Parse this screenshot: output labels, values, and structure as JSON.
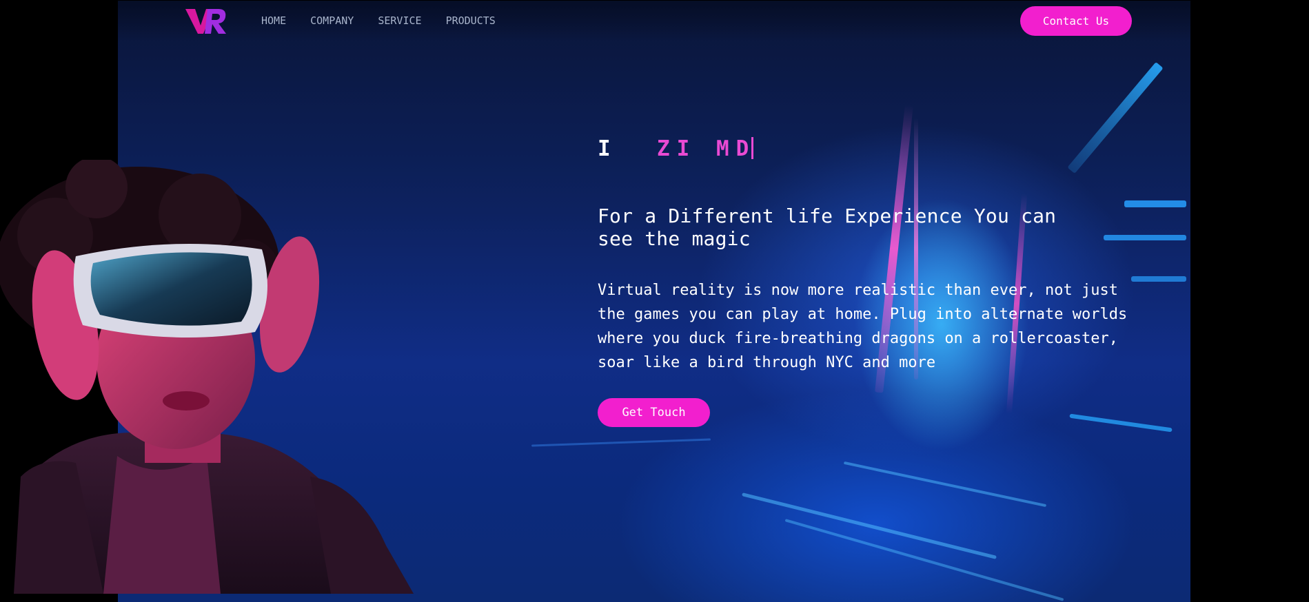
{
  "brand": {
    "logo_text": "VR",
    "accent": "#f21fce"
  },
  "nav": {
    "items": [
      {
        "label": "HOME"
      },
      {
        "label": "COMPANY"
      },
      {
        "label": "SERVICE"
      },
      {
        "label": "PRODUCTS"
      }
    ]
  },
  "header": {
    "contact_label": "Contact Us"
  },
  "hero": {
    "typing_white": "I",
    "typing_pink": "ZI MD",
    "subtitle": "For a Different life Experience You can see the magic",
    "body": "Virtual reality is now more realistic than ever, not just the games you can play at home. Plug into alternate worlds where you duck fire-breathing dragons on a rollercoaster, soar like a bird through NYC and more",
    "cta_label": "Get Touch"
  },
  "colors": {
    "background": "#000000",
    "button": "#f21fce",
    "nav_text": "#a9b5cc",
    "typing_accent": "#e94ad3"
  }
}
